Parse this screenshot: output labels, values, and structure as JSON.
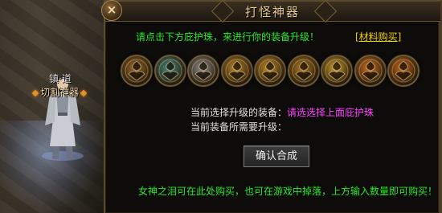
{
  "scene": {
    "player_name": "镇·道",
    "player_title": "切割神器"
  },
  "dialog": {
    "title": "打怪神器",
    "close_label": "×",
    "instruction": "请点击下方庇护珠，来进行你的装备升级！",
    "buy_link": "[材料购买]",
    "current_equip_label": "当前选择升级的装备：",
    "current_equip_value": "请选选择上面庇护珠",
    "required_label": "当前装备所需要升级：",
    "required_value": "",
    "confirm_button": "确认合成",
    "footer_note": "女神之泪可在此处购买，也可在游戏中掉落，上方输入数量即可购买！"
  },
  "orbs": [
    {
      "icon": "bronze-rune-orb-icon",
      "color": "#9a6a2c"
    },
    {
      "icon": "teal-rune-orb-icon",
      "color": "#3f8c86"
    },
    {
      "icon": "silver-rune-orb-icon",
      "color": "#8f8f8f"
    },
    {
      "icon": "gold-rune-orb-icon",
      "color": "#c08b2a"
    },
    {
      "icon": "amber-rune-orb-icon",
      "color": "#c9902a"
    },
    {
      "icon": "amber-rune-orb-icon",
      "color": "#b27c25"
    },
    {
      "icon": "gold-rune-orb-icon",
      "color": "#d0a030"
    },
    {
      "icon": "orange-rune-orb-icon",
      "color": "#d27020"
    },
    {
      "icon": "orange-rune-orb-icon",
      "color": "#c86a1c"
    }
  ],
  "colors": {
    "accent_green": "#29e629",
    "link_yellow": "#f1d000",
    "value_magenta": "#ff40ff",
    "title_gold": "#e8c98f"
  }
}
